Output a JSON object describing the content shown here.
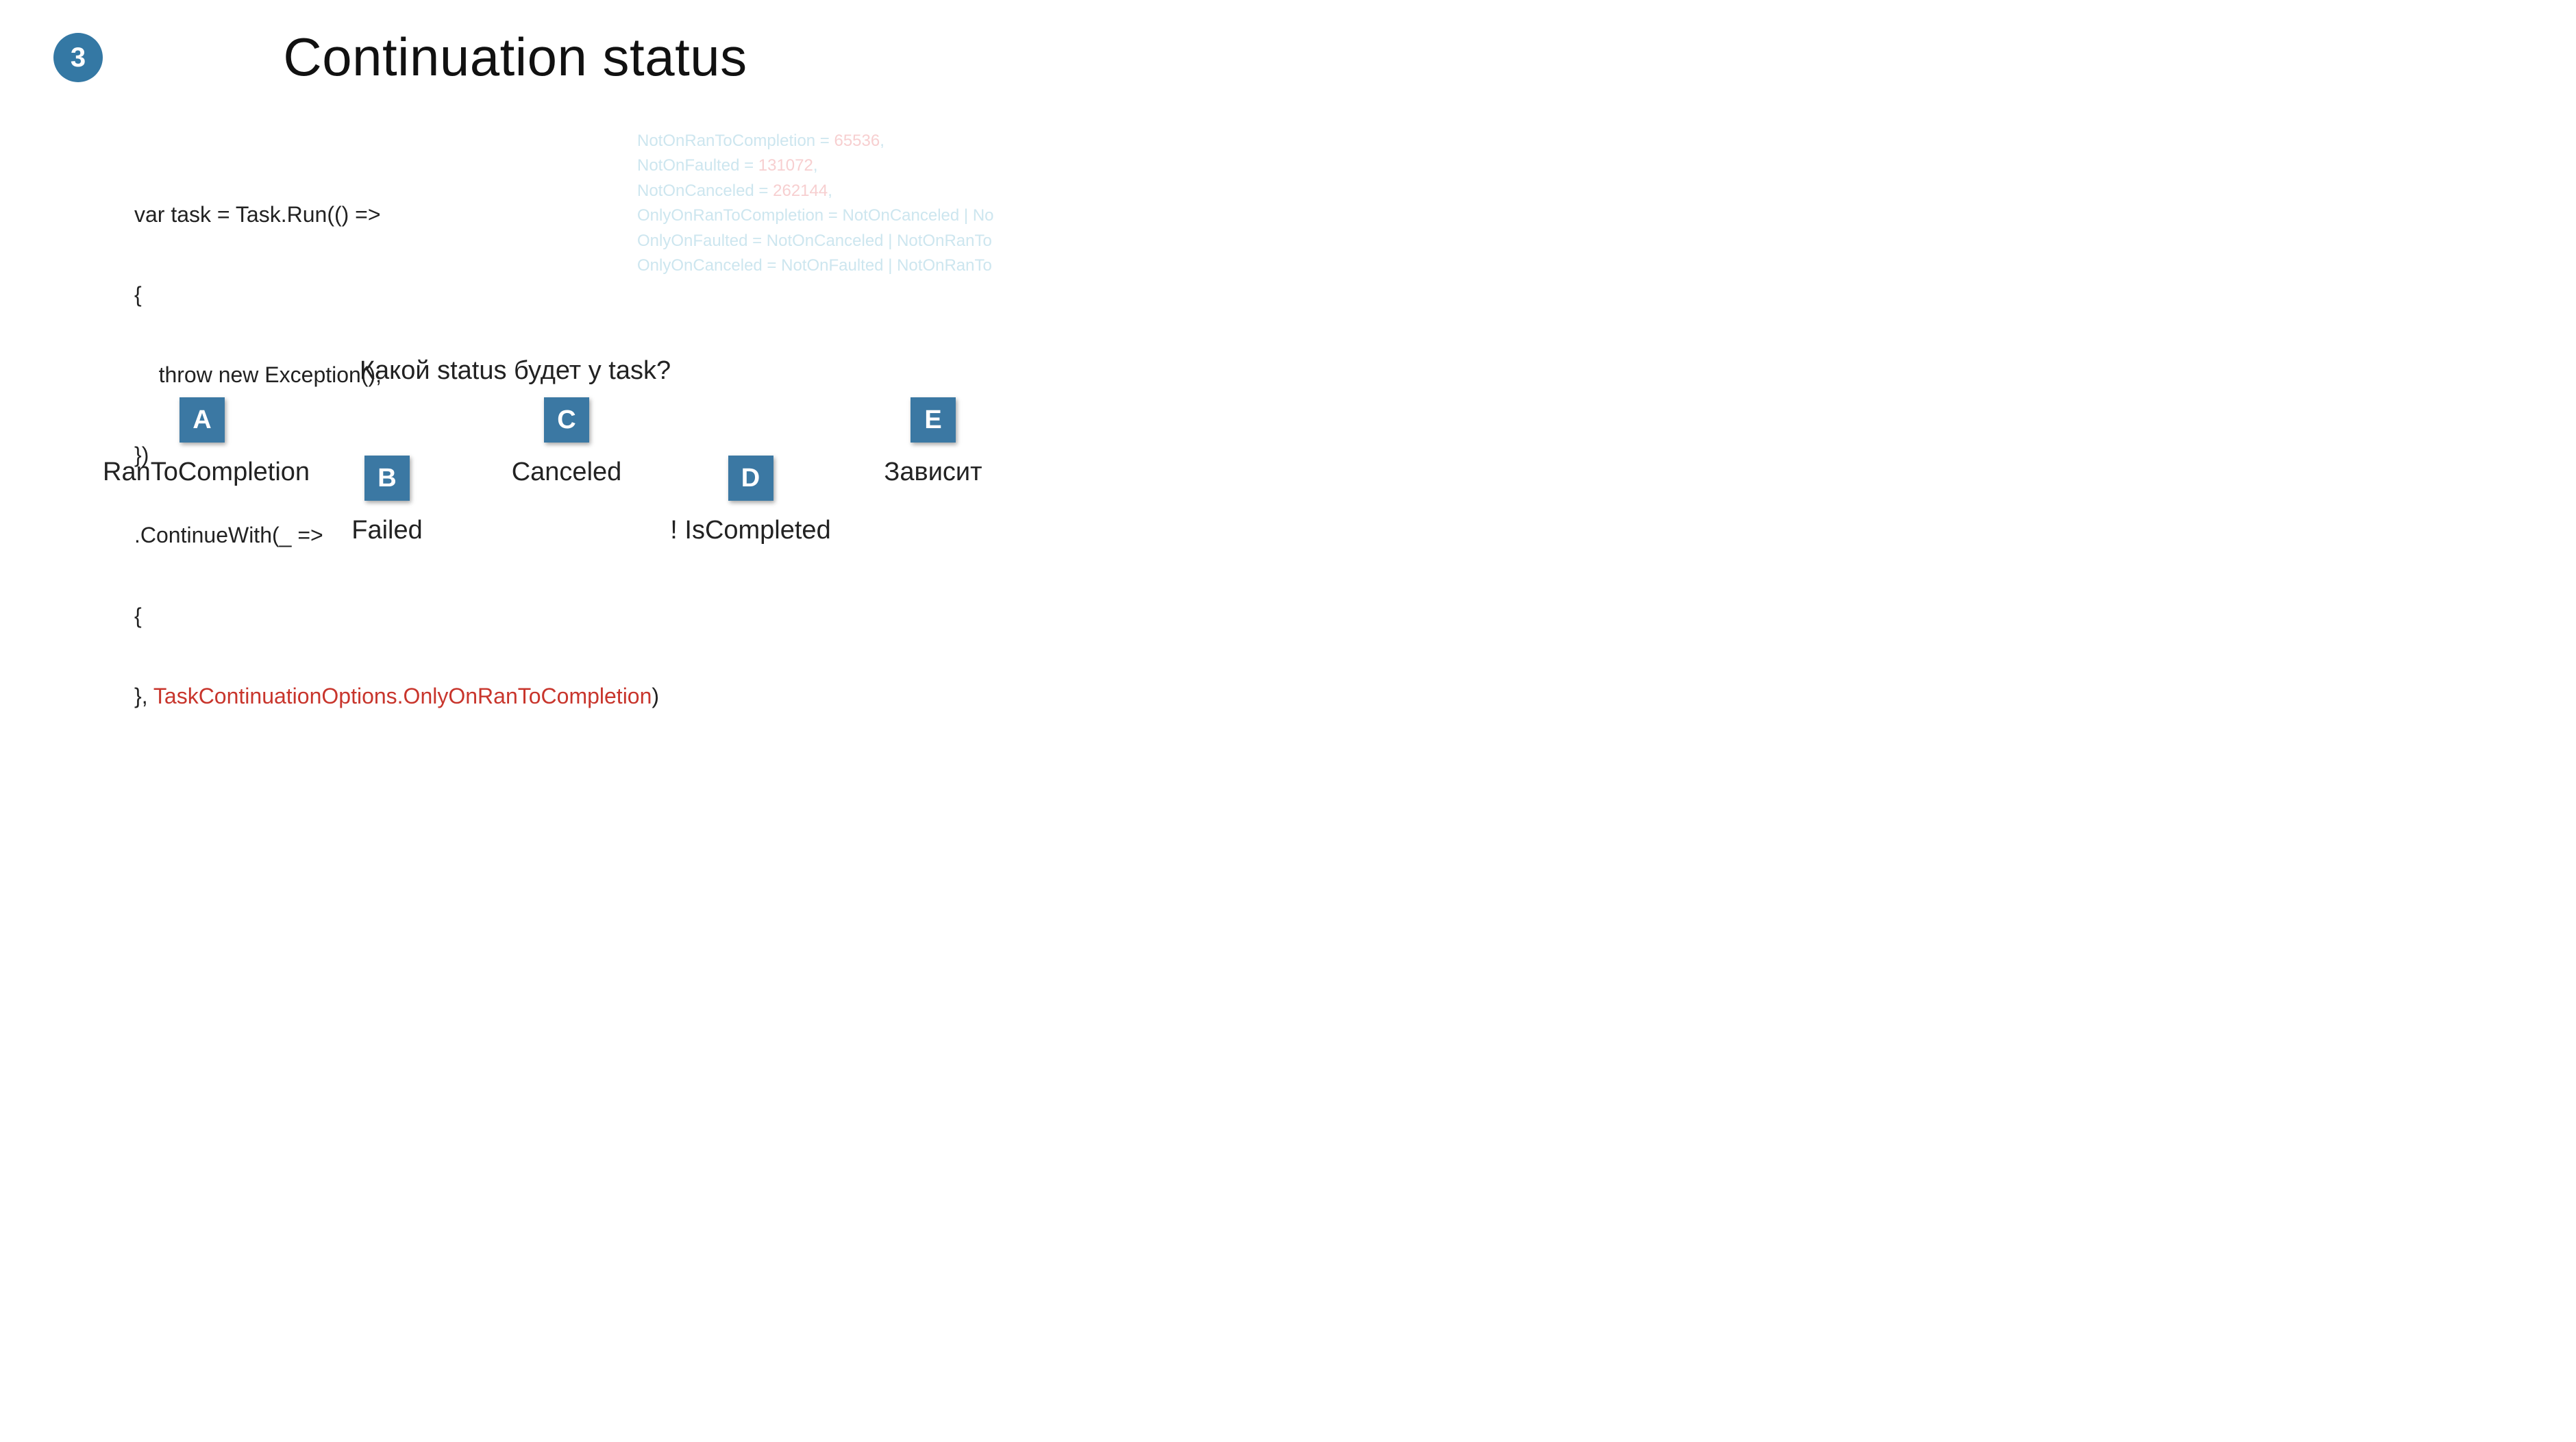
{
  "slide_number": "3",
  "title": "Continuation status",
  "code": {
    "l1": "var task = Task.Run(() =>",
    "l2": "{",
    "l3": "    throw new Exception();",
    "l4": "})",
    "l5": ".ContinueWith(_ =>",
    "l6": "{",
    "l7a": "}, ",
    "l7b": "TaskContinuationOptions.OnlyOnRanToCompletion",
    "l7c": ")"
  },
  "enum": {
    "l1a": "NotOnRanToCompletion = ",
    "l1b": "65536",
    "l1c": ",",
    "l2a": "NotOnFaulted = ",
    "l2b": "131072",
    "l2c": ",",
    "l3a": "NotOnCanceled = ",
    "l3b": "262144",
    "l3c": ",",
    "l4": "OnlyOnRanToCompletion = NotOnCanceled | No",
    "l5": "OnlyOnFaulted = NotOnCanceled | NotOnRanTo",
    "l6": "OnlyOnCanceled = NotOnFaulted | NotOnRanTo"
  },
  "question": "Какой status будет у task?",
  "options": {
    "a": {
      "letter": "A",
      "label": "RanToCompletion"
    },
    "b": {
      "letter": "B",
      "label": "Failed"
    },
    "c": {
      "letter": "C",
      "label": "Canceled"
    },
    "d": {
      "letter": "D",
      "label": "! IsCompleted"
    },
    "e": {
      "letter": "E",
      "label": "Зависит"
    }
  }
}
